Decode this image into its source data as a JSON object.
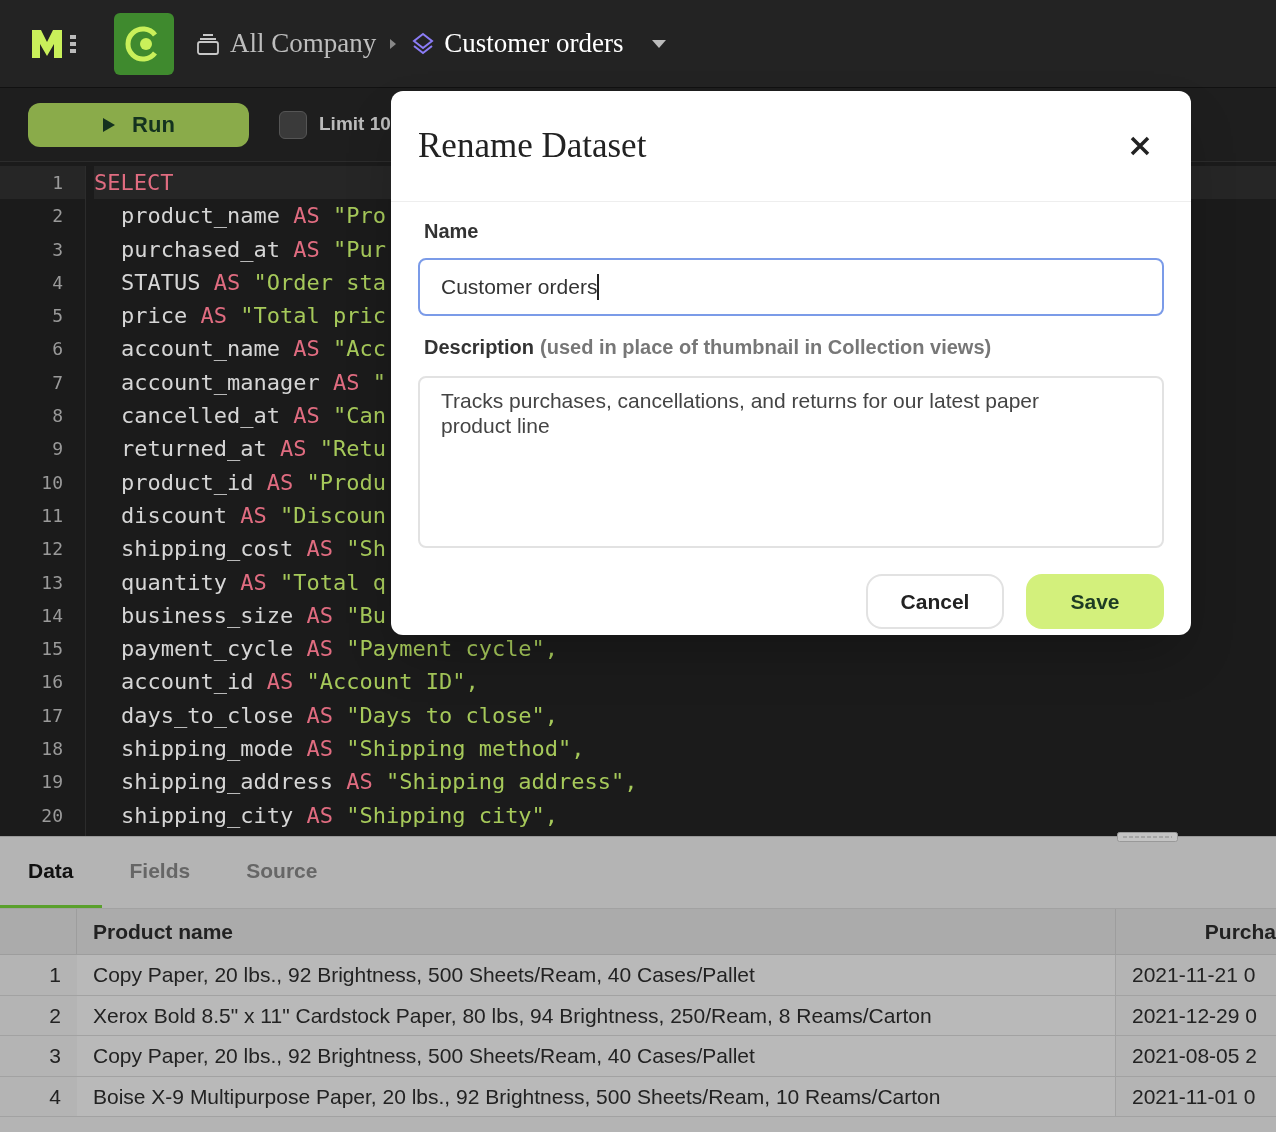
{
  "header": {
    "breadcrumb": [
      {
        "label": "All Company",
        "kind": "collection"
      },
      {
        "label": "Customer orders",
        "kind": "dataset"
      }
    ]
  },
  "toolbar": {
    "run_label": "Run",
    "limit": {
      "label": "Limit 10",
      "checked": false
    }
  },
  "editor": {
    "lines": [
      {
        "number": "1",
        "tokens": [
          {
            "kind": "keyword",
            "text": "SELECT"
          }
        ]
      },
      {
        "number": "2",
        "tokens": [
          {
            "kind": "ident",
            "text": "product_name"
          },
          {
            "kind": "keyword",
            "text": "AS"
          },
          {
            "kind": "string",
            "text": "\"Pro"
          }
        ]
      },
      {
        "number": "3",
        "tokens": [
          {
            "kind": "ident",
            "text": "purchased_at"
          },
          {
            "kind": "keyword",
            "text": "AS"
          },
          {
            "kind": "string",
            "text": "\"Pur"
          }
        ]
      },
      {
        "number": "4",
        "tokens": [
          {
            "kind": "ident",
            "text": "STATUS"
          },
          {
            "kind": "keyword",
            "text": "AS"
          },
          {
            "kind": "string",
            "text": "\"Order sta"
          }
        ]
      },
      {
        "number": "5",
        "tokens": [
          {
            "kind": "ident",
            "text": "price"
          },
          {
            "kind": "keyword",
            "text": "AS"
          },
          {
            "kind": "string",
            "text": "\"Total pric"
          }
        ]
      },
      {
        "number": "6",
        "tokens": [
          {
            "kind": "ident",
            "text": "account_name"
          },
          {
            "kind": "keyword",
            "text": "AS"
          },
          {
            "kind": "string",
            "text": "\"Acc"
          }
        ]
      },
      {
        "number": "7",
        "tokens": [
          {
            "kind": "ident",
            "text": "account_manager"
          },
          {
            "kind": "keyword",
            "text": "AS"
          },
          {
            "kind": "string",
            "text": "\""
          }
        ]
      },
      {
        "number": "8",
        "tokens": [
          {
            "kind": "ident",
            "text": "cancelled_at"
          },
          {
            "kind": "keyword",
            "text": "AS"
          },
          {
            "kind": "string",
            "text": "\"Can"
          }
        ]
      },
      {
        "number": "9",
        "tokens": [
          {
            "kind": "ident",
            "text": "returned_at"
          },
          {
            "kind": "keyword",
            "text": "AS"
          },
          {
            "kind": "string",
            "text": "\"Retu"
          }
        ]
      },
      {
        "number": "10",
        "tokens": [
          {
            "kind": "ident",
            "text": "product_id"
          },
          {
            "kind": "keyword",
            "text": "AS"
          },
          {
            "kind": "string",
            "text": "\"Produ"
          }
        ]
      },
      {
        "number": "11",
        "tokens": [
          {
            "kind": "ident",
            "text": "discount"
          },
          {
            "kind": "keyword",
            "text": "AS"
          },
          {
            "kind": "string",
            "text": "\"Discoun"
          }
        ]
      },
      {
        "number": "12",
        "tokens": [
          {
            "kind": "ident",
            "text": "shipping_cost"
          },
          {
            "kind": "keyword",
            "text": "AS"
          },
          {
            "kind": "string",
            "text": "\"Sh"
          }
        ]
      },
      {
        "number": "13",
        "tokens": [
          {
            "kind": "ident",
            "text": "quantity"
          },
          {
            "kind": "keyword",
            "text": "AS"
          },
          {
            "kind": "string",
            "text": "\"Total q"
          }
        ]
      },
      {
        "number": "14",
        "tokens": [
          {
            "kind": "ident",
            "text": "business_size"
          },
          {
            "kind": "keyword",
            "text": "AS"
          },
          {
            "kind": "string",
            "text": "\"Bu"
          }
        ]
      },
      {
        "number": "15",
        "tokens": [
          {
            "kind": "ident",
            "text": "payment_cycle"
          },
          {
            "kind": "keyword",
            "text": "AS"
          },
          {
            "kind": "string",
            "text": "\"Payment cycle\","
          }
        ]
      },
      {
        "number": "16",
        "tokens": [
          {
            "kind": "ident",
            "text": "account_id"
          },
          {
            "kind": "keyword",
            "text": "AS"
          },
          {
            "kind": "string",
            "text": "\"Account ID\","
          }
        ]
      },
      {
        "number": "17",
        "tokens": [
          {
            "kind": "ident",
            "text": "days_to_close"
          },
          {
            "kind": "keyword",
            "text": "AS"
          },
          {
            "kind": "string",
            "text": "\"Days to close\","
          }
        ]
      },
      {
        "number": "18",
        "tokens": [
          {
            "kind": "ident",
            "text": "shipping_mode"
          },
          {
            "kind": "keyword",
            "text": "AS"
          },
          {
            "kind": "string",
            "text": "\"Shipping method\","
          }
        ]
      },
      {
        "number": "19",
        "tokens": [
          {
            "kind": "ident",
            "text": "shipping_address"
          },
          {
            "kind": "keyword",
            "text": "AS"
          },
          {
            "kind": "string",
            "text": "\"Shipping address\","
          }
        ]
      },
      {
        "number": "20",
        "tokens": [
          {
            "kind": "ident",
            "text": "shipping_city"
          },
          {
            "kind": "keyword",
            "text": "AS"
          },
          {
            "kind": "string",
            "text": "\"Shipping city\","
          }
        ]
      }
    ]
  },
  "results": {
    "tabs": [
      {
        "label": "Data",
        "selected": true
      },
      {
        "label": "Fields",
        "selected": false
      },
      {
        "label": "Source",
        "selected": false
      }
    ],
    "columns": [
      "Product name",
      "Purcha"
    ],
    "rows": [
      {
        "index": "1",
        "cells": [
          "Copy Paper, 20 lbs., 92 Brightness, 500 Sheets/Ream, 40 Cases/Pallet",
          "2021-11-21 0"
        ]
      },
      {
        "index": "2",
        "cells": [
          "Xerox Bold 8.5\" x 11\" Cardstock Paper, 80 lbs, 94 Brightness, 250/Ream, 8 Reams/Carton",
          "2021-12-29 0"
        ]
      },
      {
        "index": "3",
        "cells": [
          "Copy Paper, 20 lbs., 92 Brightness, 500 Sheets/Ream, 40 Cases/Pallet",
          "2021-08-05 2"
        ]
      },
      {
        "index": "4",
        "cells": [
          "Boise X-9 Multipurpose Paper, 20 lbs., 92 Brightness, 500 Sheets/Ream, 10 Reams/Carton",
          "2021-11-01 0"
        ]
      }
    ]
  },
  "dialog": {
    "title": "Rename Dataset",
    "name_label": "Name",
    "name_value": "Customer orders",
    "description_label": "Description",
    "description_hint": "(used in place of thumbnail in Collection views)",
    "description_value": "Tracks purchases, cancellations, and returns for our latest paper product line",
    "buttons": [
      {
        "label": "Cancel",
        "kind": "secondary"
      },
      {
        "label": "Save",
        "kind": "primary"
      }
    ]
  }
}
